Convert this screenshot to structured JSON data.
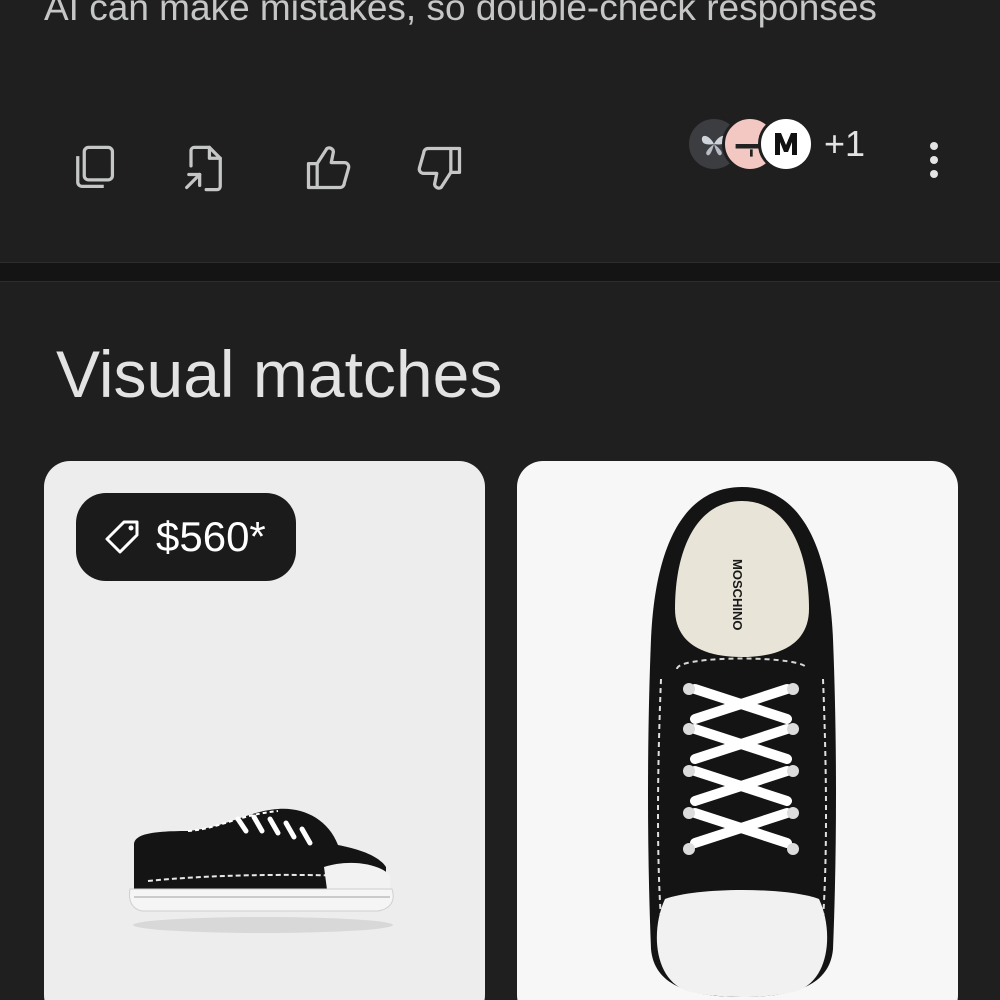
{
  "ai_response": {
    "disclaimer": "AI can make mistakes, so double-check responses",
    "actions": [
      {
        "name": "copy",
        "icon": "copy-icon"
      },
      {
        "name": "export",
        "icon": "export-doc-icon"
      },
      {
        "name": "good-response",
        "icon": "thumbs-up-icon"
      },
      {
        "name": "bad-response",
        "icon": "thumbs-down-icon"
      }
    ],
    "sources": {
      "avatars": [
        "source-avatar-butterfly",
        "source-avatar-pink",
        "source-avatar-m"
      ],
      "extra_count": "+1"
    },
    "more_icon": "more-vert-icon"
  },
  "visual_matches": {
    "title": "Visual matches",
    "items": [
      {
        "price": "$560*",
        "tag_icon": "price-tag-icon",
        "image": "black canvas sneaker side view"
      },
      {
        "image": "black canvas sneaker top view",
        "insole_brand": "MOSCHINO"
      }
    ]
  },
  "colors": {
    "background": "#1f1f1f",
    "text": "#e3e3e3",
    "muted_text": "#c4c7c5",
    "badge": "#1b1b1b"
  }
}
